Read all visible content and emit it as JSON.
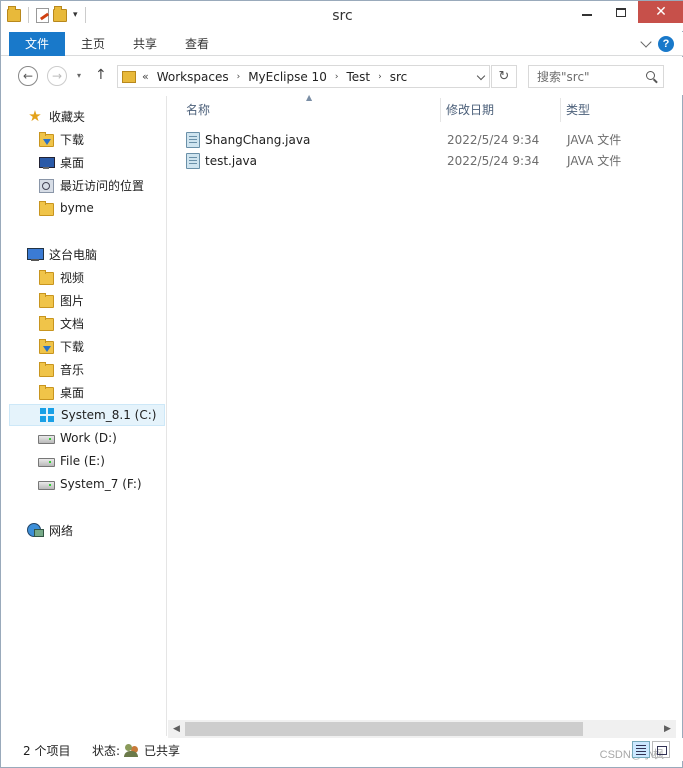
{
  "window": {
    "title": "src",
    "minimize_icon": "minimize-icon",
    "maximize_icon": "maximize-icon",
    "close_glyph": "✕"
  },
  "ribbon": {
    "tabs": [
      "文件",
      "主页",
      "共享",
      "查看"
    ],
    "accent": "#1979ca",
    "help_glyph": "?"
  },
  "nav": {
    "back_glyph": "←",
    "forward_glyph": "→",
    "up_glyph": "↑",
    "dropdown_glyph": "▾",
    "overflow_glyph": "«",
    "breadcrumb": [
      "Workspaces",
      "MyEclipse 10",
      "Test",
      "src"
    ],
    "crumb_separator": "›",
    "refresh_glyph": "↻",
    "search_placeholder": "搜索\"src\""
  },
  "sidebar": {
    "favorites": {
      "label": "收藏夹",
      "items": [
        "下载",
        "桌面",
        "最近访问的位置",
        "byme"
      ]
    },
    "this_pc": {
      "label": "这台电脑",
      "items": [
        "视频",
        "图片",
        "文档",
        "下载",
        "音乐",
        "桌面",
        "System_8.1 (C:)",
        "Work (D:)",
        "File (E:)",
        "System_7 (F:)"
      ],
      "selected": "System_8.1 (C:)"
    },
    "network": {
      "label": "网络"
    }
  },
  "columns": {
    "name": "名称",
    "date": "修改日期",
    "type": "类型"
  },
  "files": [
    {
      "name": "ShangChang.java",
      "date": "2022/5/24 9:34",
      "type": "JAVA 文件"
    },
    {
      "name": "test.java",
      "date": "2022/5/24 9:34",
      "type": "JAVA 文件"
    }
  ],
  "status": {
    "count": "2 个项目",
    "state_label": "状态:",
    "state_value": "已共享"
  },
  "watermark": "CSDN@小枫"
}
